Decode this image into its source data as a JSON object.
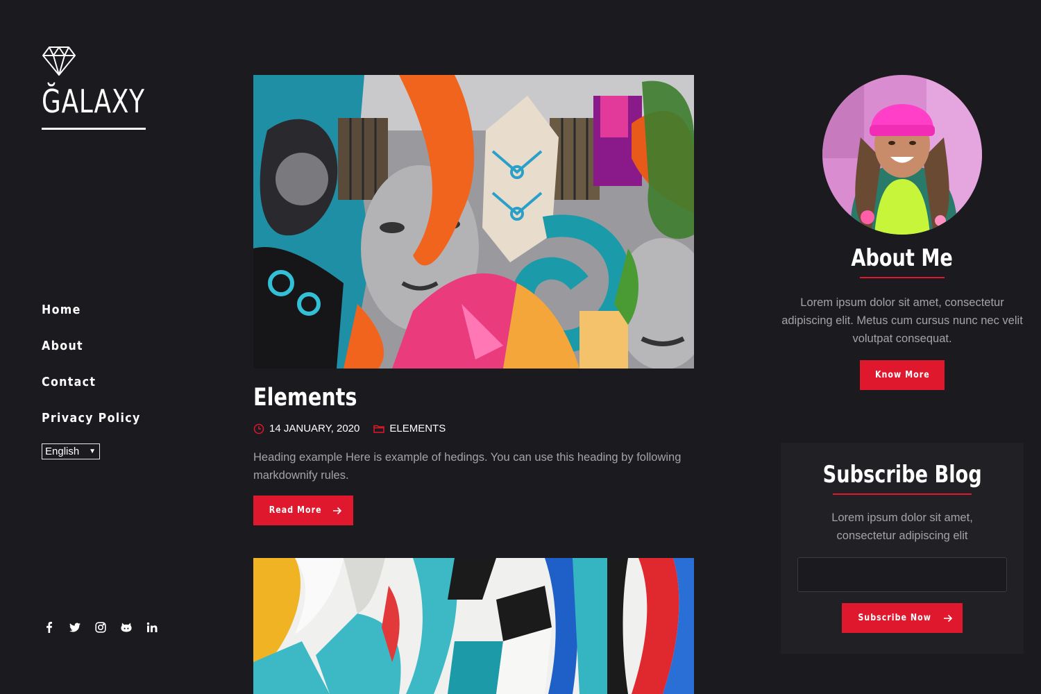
{
  "brand": {
    "name": "ĞALAXY",
    "icon": "diamond-icon"
  },
  "nav": {
    "items": [
      {
        "label": "Home"
      },
      {
        "label": "About"
      },
      {
        "label": "Contact"
      },
      {
        "label": "Privacy Policy"
      }
    ]
  },
  "language": {
    "selected": "English"
  },
  "social": {
    "icons": [
      "facebook-icon",
      "twitter-icon",
      "instagram-icon",
      "github-icon",
      "linkedin-icon"
    ]
  },
  "posts": [
    {
      "title": "Elements",
      "date": "14 JANUARY, 2020",
      "category": "ELEMENTS",
      "excerpt": "Heading example Here is example of hedings. You can use this heading by following markdownify rules.",
      "button": "Read More"
    }
  ],
  "about": {
    "title": "About Me",
    "text": "Lorem ipsum dolor sit amet, consectetur adipiscing elit. Metus cum cursus nunc nec velit volutpat consequat.",
    "button": "Know More"
  },
  "subscribe": {
    "title": "Subscribe Blog",
    "text": "Lorem ipsum dolor sit amet, consectetur adipiscing elit",
    "button": "Subscribe Now"
  },
  "colors": {
    "background": "#1a1a1f",
    "accent": "#e0182d",
    "muted_text": "#a3a3a8"
  }
}
